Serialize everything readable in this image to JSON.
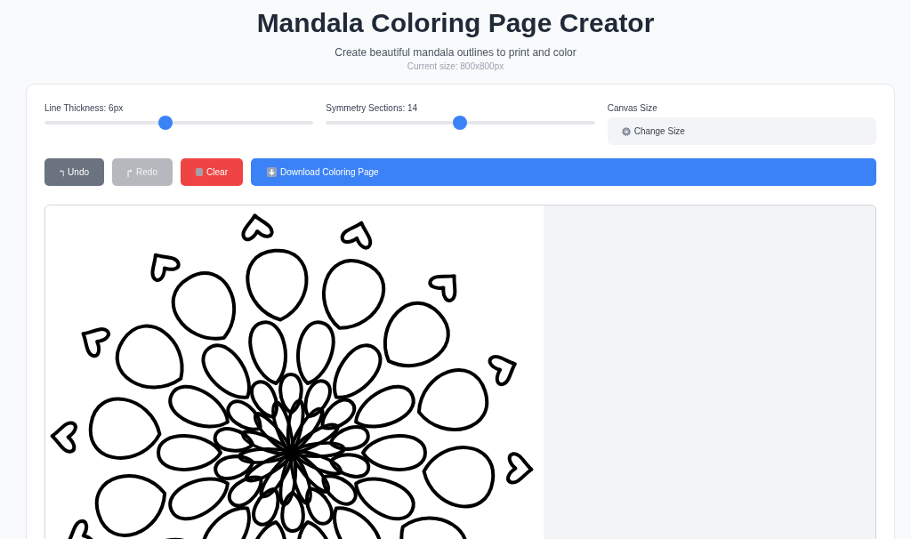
{
  "header": {
    "title": "Mandala Coloring Page Creator",
    "subtitle": "Create beautiful mandala outlines to print and color",
    "size_note": "Current size: 800x800px"
  },
  "controls": {
    "sliders": [
      {
        "label": "Line Thickness: 6px",
        "level": 0.45
      },
      {
        "label": "Symmetry Sections: 14",
        "level": 0.5
      }
    ],
    "canvas_size": {
      "label": "Canvas Size",
      "button": "Change Size"
    }
  },
  "buttons": [
    {
      "kind": "undo",
      "label": "Undo",
      "disabled": false
    },
    {
      "kind": "redo",
      "label": "Redo",
      "disabled": true
    },
    {
      "kind": "clear",
      "label": "Clear",
      "disabled": false
    },
    {
      "kind": "download",
      "label": "Download Coloring Page",
      "disabled": false
    }
  ]
}
